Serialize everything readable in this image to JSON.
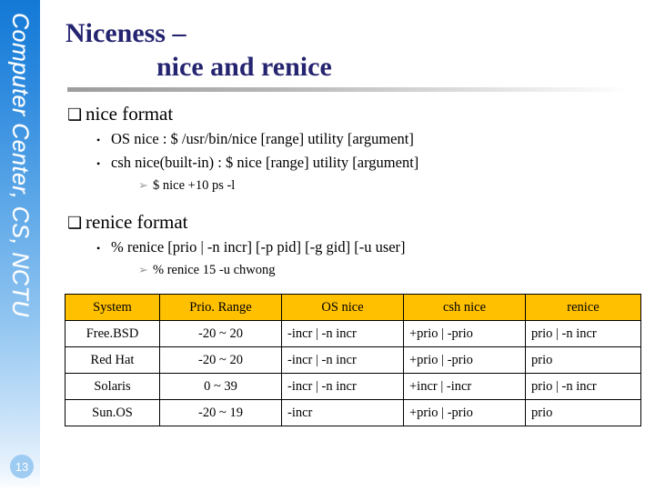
{
  "sidebar": {
    "banner_text": "Computer Center, CS, NCTU",
    "page_number": "13",
    "gradient_top_color": "#1379d6",
    "gradient_bottom_color": "#ffffff",
    "badge_color": "#9ecbf2"
  },
  "title": {
    "line1": "Niceness –",
    "line2": "nice and renice",
    "color": "#252470"
  },
  "content": {
    "sections": [
      {
        "heading": "nice format",
        "bullet_glyph": "❑",
        "items": [
          {
            "marker": "•",
            "text": "OS nice : $ /usr/bin/nice [range] utility [argument]",
            "subitems": []
          },
          {
            "marker": "•",
            "text": "csh nice(built-in) : $ nice  [range] utility [argument]",
            "subitems": [
              {
                "marker": "➢",
                "text": "$ nice +10 ps -l"
              }
            ]
          }
        ]
      },
      {
        "heading": "renice format",
        "bullet_glyph": "❑",
        "items": [
          {
            "marker": "•",
            "text": "% renice [prio | -n incr] [-p pid] [-g gid] [-u user]",
            "subitems": [
              {
                "marker": "➢",
                "text": "% renice 15 ‑u chwong"
              }
            ]
          }
        ]
      }
    ]
  },
  "table": {
    "header_bg": "#FFC000",
    "border_color": "#000000",
    "columns": [
      "System",
      "Prio. Range",
      "OS nice",
      "csh nice",
      "renice"
    ],
    "rows": [
      {
        "system": "Free.BSD",
        "prio_range": "-20 ~ 20",
        "os_nice": "-incr | -n incr",
        "csh_nice": "+prio | -prio",
        "renice": "prio | -n incr"
      },
      {
        "system": "Red Hat",
        "prio_range": "-20 ~ 20",
        "os_nice": "-incr | -n incr",
        "csh_nice": "+prio | -prio",
        "renice": "prio"
      },
      {
        "system": "Solaris",
        "prio_range": "0 ~ 39",
        "os_nice": "-incr | -n incr",
        "csh_nice": "+incr | -incr",
        "renice": "prio | -n incr"
      },
      {
        "system": "Sun.OS",
        "prio_range": "-20 ~ 19",
        "os_nice": "-incr",
        "csh_nice": "+prio | -prio",
        "renice": "prio"
      }
    ]
  }
}
